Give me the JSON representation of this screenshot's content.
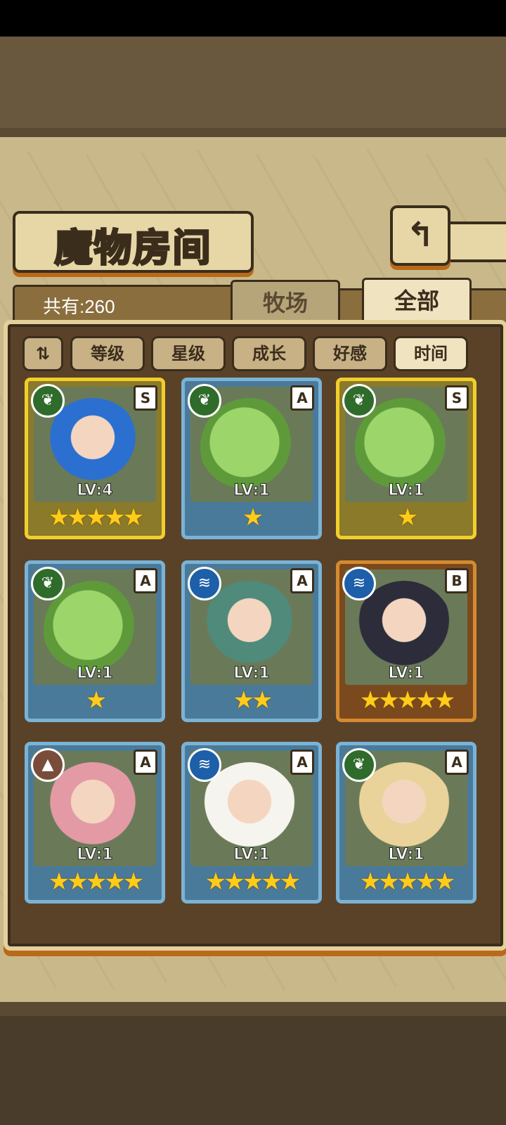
{
  "header": {
    "title": "魔物房间",
    "back_icon": "↰"
  },
  "summary": {
    "count_label": "共有:260"
  },
  "tabs": [
    {
      "label": "牧场",
      "active": false
    },
    {
      "label": "全部",
      "active": true
    }
  ],
  "sort": {
    "toggle_icon": "⇅",
    "buttons": [
      {
        "label": "等级",
        "active": false
      },
      {
        "label": "星级",
        "active": false
      },
      {
        "label": "成长",
        "active": false
      },
      {
        "label": "好感",
        "active": false
      },
      {
        "label": "时间",
        "active": true
      }
    ]
  },
  "cards": [
    {
      "element": "nature",
      "rank": "S",
      "level": "LV:4",
      "stars": "★★★★★",
      "frame": "gold",
      "art": "girl-a"
    },
    {
      "element": "nature",
      "rank": "A",
      "level": "LV:1",
      "stars": "★",
      "frame": "blue",
      "art": "slime"
    },
    {
      "element": "nature",
      "rank": "S",
      "level": "LV:1",
      "stars": "★",
      "frame": "gold",
      "art": "slime"
    },
    {
      "element": "nature",
      "rank": "A",
      "level": "LV:1",
      "stars": "★",
      "frame": "blue",
      "art": "slime"
    },
    {
      "element": "water",
      "rank": "A",
      "level": "LV:1",
      "stars": "★★",
      "frame": "blue",
      "art": "girl-b"
    },
    {
      "element": "water",
      "rank": "B",
      "level": "LV:1",
      "stars": "★★★★★",
      "frame": "bronze",
      "art": "girl-c"
    },
    {
      "element": "earth",
      "rank": "A",
      "level": "LV:1",
      "stars": "★★★★★",
      "frame": "blue",
      "art": "girl-d"
    },
    {
      "element": "water",
      "rank": "A",
      "level": "LV:1",
      "stars": "★★★★★",
      "frame": "blue",
      "art": "girl-e"
    },
    {
      "element": "nature",
      "rank": "A",
      "level": "LV:1",
      "stars": "★★★★★",
      "frame": "blue",
      "art": "girl-f"
    }
  ],
  "colors": {
    "accent": "#b86a1a",
    "parchment": "#c9b98a",
    "frame_dark": "#3b2d1c"
  }
}
